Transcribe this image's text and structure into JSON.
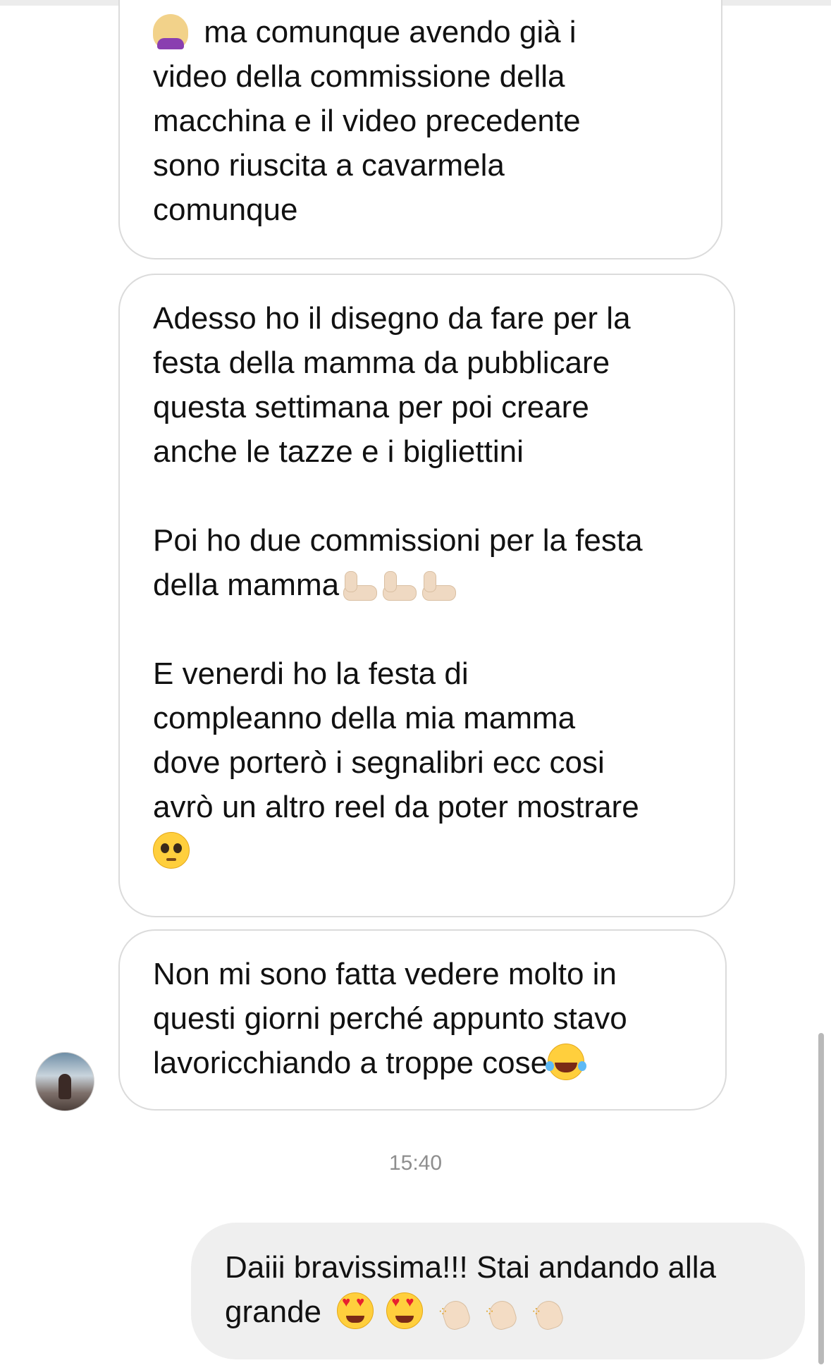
{
  "messages": {
    "m1": {
      "lines": [
        "ma comunque avendo già i",
        "video della commissione della",
        "macchina e il video precedente",
        "sono riuscita a cavarmela",
        "comunque"
      ]
    },
    "m2": {
      "lines": [
        "Adesso ho il disegno da fare per la",
        "festa della mamma da pubblicare",
        "questa settimana per poi creare",
        "anche le tazze e i bigliettini",
        "Poi ho due commissioni per la festa",
        "della mamma",
        "E venerdi ho la festa di",
        "compleanno della mia mamma",
        "dove porterò i segnalibri ecc cosi",
        "avrò un altro reel da poter mostrare"
      ]
    },
    "m3": {
      "lines": [
        "Non mi sono fatta vedere molto in",
        "questi giorni perché appunto stavo",
        "lavoricchiando a troppe cose"
      ]
    },
    "timestamp": "15:40",
    "sent": {
      "lines": [
        "Daiii bravissima!!! Stai andando alla",
        "grande"
      ]
    }
  },
  "icons": {
    "facepalm": "woman-facepalming-emoji",
    "muscle": "flexed-biceps-emoji",
    "pleading": "pleading-face-emoji",
    "joy": "face-with-tears-of-joy-emoji",
    "hearts": "heart-eyes-emoji",
    "clap": "clapping-hands-emoji"
  },
  "colors": {
    "received_border": "#dbdbdb",
    "sent_bubble": "#efefef",
    "timestamp": "#8e8e8e"
  }
}
